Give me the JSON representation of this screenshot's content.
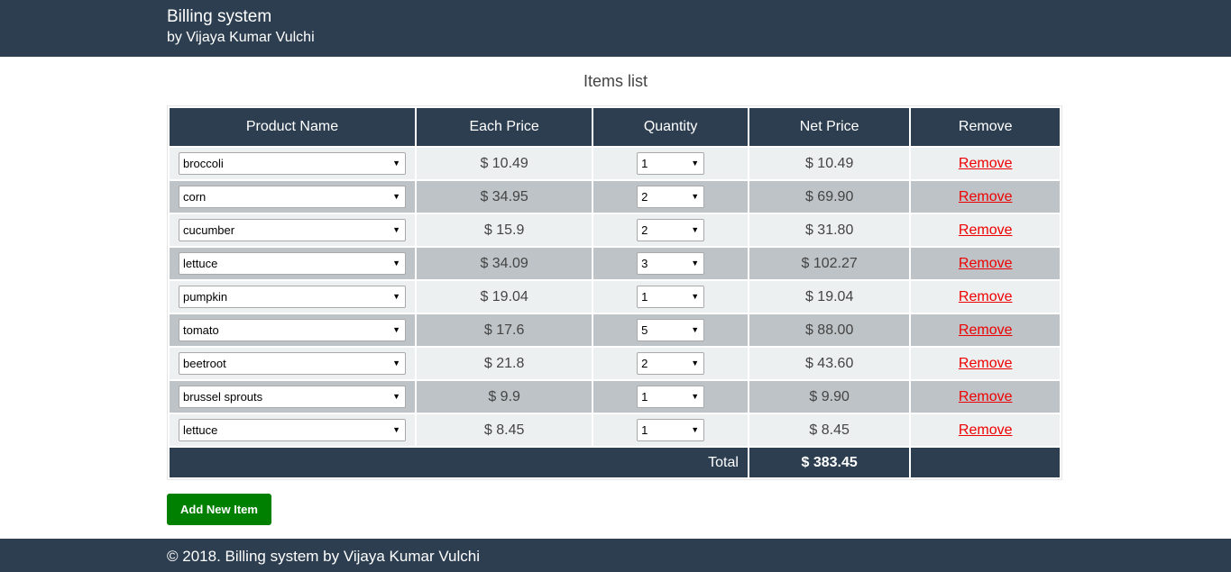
{
  "header": {
    "title": "Billing system",
    "subtitle": "by Vijaya Kumar Vulchi"
  },
  "list_title": "Items list",
  "table": {
    "columns": [
      "Product Name",
      "Each Price",
      "Quantity",
      "Net Price",
      "Remove"
    ],
    "rows": [
      {
        "product": "broccoli",
        "each_price": "$ 10.49",
        "quantity": "1",
        "net_price": "$ 10.49",
        "remove": "Remove"
      },
      {
        "product": "corn",
        "each_price": "$ 34.95",
        "quantity": "2",
        "net_price": "$ 69.90",
        "remove": "Remove"
      },
      {
        "product": "cucumber",
        "each_price": "$ 15.9",
        "quantity": "2",
        "net_price": "$ 31.80",
        "remove": "Remove"
      },
      {
        "product": "lettuce",
        "each_price": "$ 34.09",
        "quantity": "3",
        "net_price": "$ 102.27",
        "remove": "Remove"
      },
      {
        "product": "pumpkin",
        "each_price": "$ 19.04",
        "quantity": "1",
        "net_price": "$ 19.04",
        "remove": "Remove"
      },
      {
        "product": "tomato",
        "each_price": "$ 17.6",
        "quantity": "5",
        "net_price": "$ 88.00",
        "remove": "Remove"
      },
      {
        "product": "beetroot",
        "each_price": "$ 21.8",
        "quantity": "2",
        "net_price": "$ 43.60",
        "remove": "Remove"
      },
      {
        "product": "brussel sprouts",
        "each_price": "$ 9.9",
        "quantity": "1",
        "net_price": "$ 9.90",
        "remove": "Remove"
      },
      {
        "product": "lettuce",
        "each_price": "$ 8.45",
        "quantity": "1",
        "net_price": "$ 8.45",
        "remove": "Remove"
      }
    ],
    "total_label": "Total",
    "total_value": "$ 383.45"
  },
  "add_button_label": "Add New Item",
  "footer": {
    "text": "© 2018. Billing system by Vijaya Kumar Vulchi"
  },
  "icons": {
    "dropdown": "chevron-down-icon"
  },
  "colors": {
    "navy": "#2c3e50",
    "row_light": "#ecf0f1",
    "row_dark": "#bdc3c7",
    "remove_link": "#e00000",
    "add_button": "#008000"
  }
}
